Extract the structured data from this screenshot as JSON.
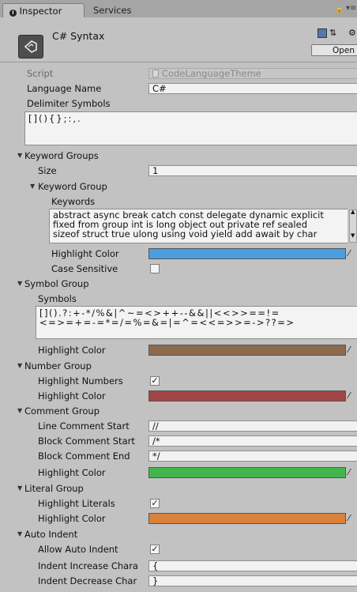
{
  "tabs": [
    {
      "label": "Inspector",
      "icon": "info-icon"
    },
    {
      "label": "Services"
    }
  ],
  "header": {
    "title": "C# Syntax",
    "open_label": "Open",
    "icons": [
      "lock-icon",
      "menu-icon",
      "help-book-icon",
      "preset-icon",
      "gear-icon"
    ]
  },
  "script": {
    "label": "Script",
    "value": "CodeLanguageTheme"
  },
  "language_name": {
    "label": "Language Name",
    "value": "C#"
  },
  "delimiter_symbols": {
    "label": "Delimiter Symbols",
    "value": "[](){};:,."
  },
  "keyword_groups": {
    "label": "Keyword Groups",
    "size_label": "Size",
    "size_value": "1",
    "group_label": "Keyword Group",
    "keywords_label": "Keywords",
    "keywords_text": "abstract async break catch const delegate dynamic explicit\nfixed from group int is long object out private ref sealed\nsizeof struct true ulong using void yield add await by char",
    "highlight_color_label": "Highlight Color",
    "highlight_color": "#4a9ee2",
    "case_sensitive_label": "Case Sensitive",
    "case_sensitive": false
  },
  "symbol_group": {
    "label": "Symbol Group",
    "symbols_label": "Symbols",
    "symbols_text": "[]().?:+-*/%&|^~=<>++--&&||<<>>==!=\n<=>=+=-=*=/=%=&=|=^=<<=>>=->??=>",
    "highlight_color_label": "Highlight Color",
    "highlight_color": "#8c6a4c"
  },
  "number_group": {
    "label": "Number Group",
    "highlight_numbers_label": "Highlight Numbers",
    "highlight_numbers": true,
    "highlight_color_label": "Highlight Color",
    "highlight_color": "#a24547"
  },
  "comment_group": {
    "label": "Comment Group",
    "line_start_label": "Line Comment Start",
    "line_start_value": "//",
    "block_start_label": "Block Comment Start",
    "block_start_value": "/*",
    "block_end_label": "Block Comment End",
    "block_end_value": "*/",
    "highlight_color_label": "Highlight Color",
    "highlight_color": "#42b64c"
  },
  "literal_group": {
    "label": "Literal Group",
    "highlight_literals_label": "Highlight Literals",
    "highlight_literals": true,
    "highlight_color_label": "Highlight Color",
    "highlight_color": "#d8823c"
  },
  "auto_indent": {
    "label": "Auto Indent",
    "allow_label": "Allow Auto Indent",
    "allow": true,
    "increase_label": "Indent Increase Chara",
    "increase_value": "{",
    "decrease_label": "Indent Decrease Char",
    "decrease_value": "}"
  }
}
